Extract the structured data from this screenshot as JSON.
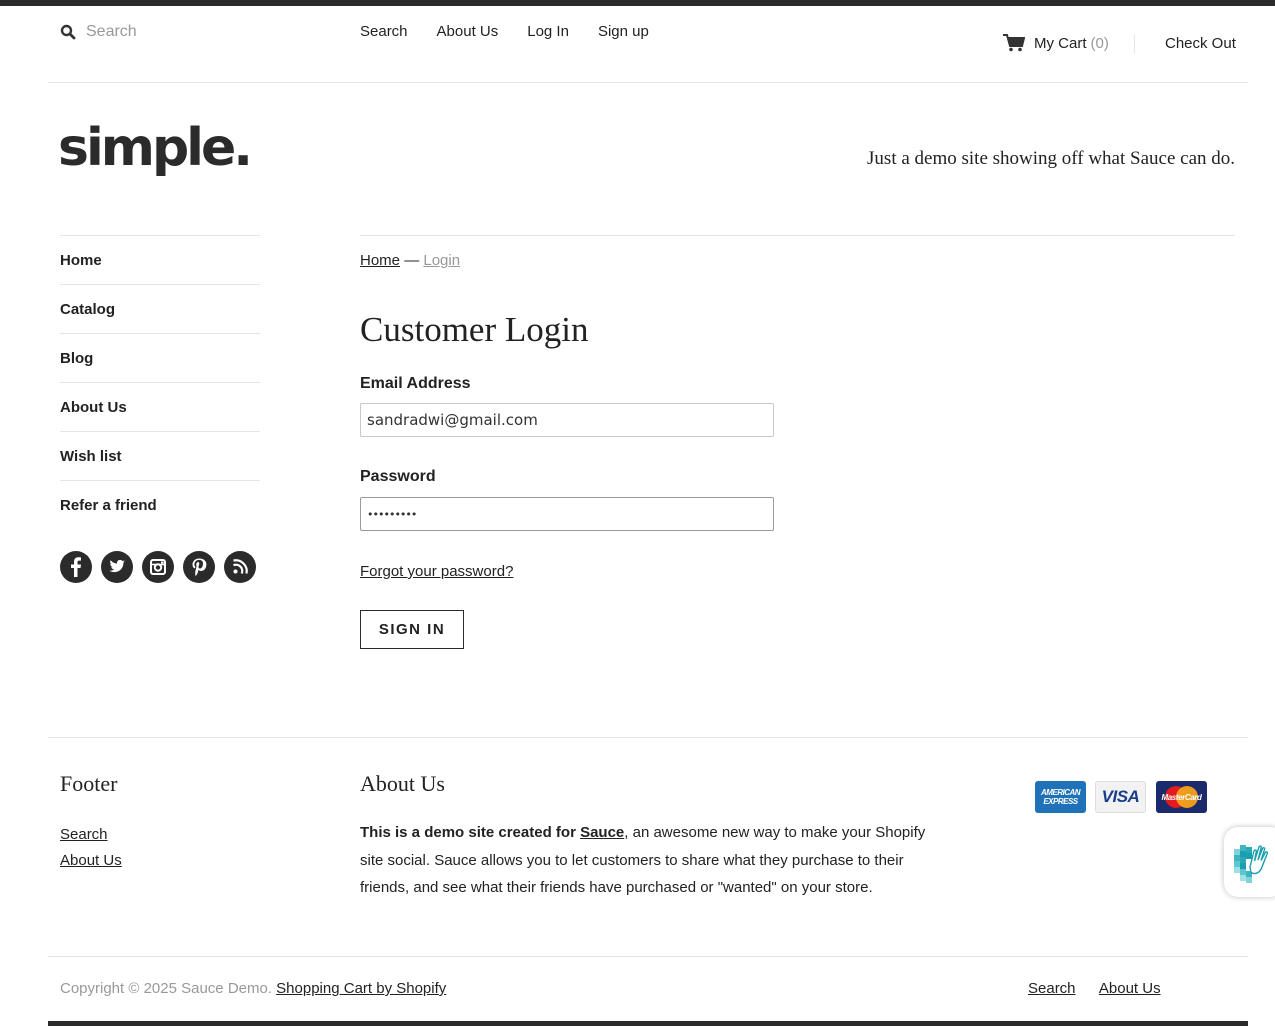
{
  "header": {
    "search_placeholder": "Search",
    "nav": [
      "Search",
      "About Us",
      "Log In",
      "Sign up"
    ],
    "cart_label": "My Cart",
    "cart_count": "(0)",
    "checkout_label": "Check Out"
  },
  "brand": {
    "logo_text": "simple.",
    "tagline": "Just a demo site showing off what Sauce can do."
  },
  "sidebar": {
    "items": [
      "Home",
      "Catalog",
      "Blog",
      "About Us",
      "Wish list",
      "Refer a friend"
    ],
    "social_icons": [
      "facebook-icon",
      "twitter-icon",
      "instagram-icon",
      "pinterest-icon",
      "rss-icon"
    ]
  },
  "breadcrumb": {
    "home": "Home",
    "separator": "—",
    "current": "Login"
  },
  "login": {
    "title": "Customer Login",
    "email_label": "Email Address",
    "email_value": "sandradwi@gmail.com",
    "password_label": "Password",
    "password_value": "sandradwi",
    "forgot_label": "Forgot your password?",
    "submit_label": "SIGN IN"
  },
  "footer": {
    "col1_title": "Footer",
    "col1_links": [
      "Search",
      "About Us"
    ],
    "col2_title": "About Us",
    "about_bold": "This is a demo site created for",
    "about_link": "Sauce",
    "about_rest": ", an awesome new way to make your Shopify site social. Sauce allows you to let customers to share what they purchase to their friends, and see what their friends have purchased or \"wanted\" on your store.",
    "payment_icons": [
      "american-express-icon",
      "visa-icon",
      "mastercard-icon"
    ],
    "amex_text": [
      "AMERICAN",
      "EXPRESS"
    ],
    "visa_text": "VISA",
    "mastercard_text": "MasterCard",
    "copyright": "Copyright © 2025 Sauce Demo.",
    "shopify_link": "Shopping Cart by Shopify",
    "bottom_nav": [
      "Search",
      "About Us"
    ]
  },
  "colors": {
    "text": "#222222",
    "muted": "#999999",
    "border": "#e5e5e5",
    "dark_bar": "#2b2b2b"
  }
}
